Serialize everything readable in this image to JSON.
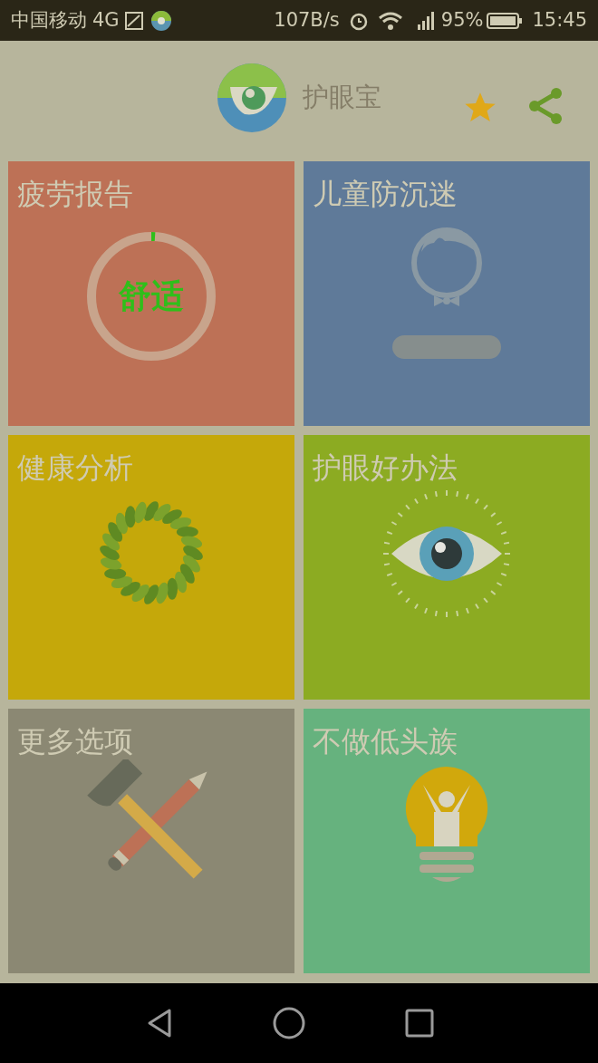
{
  "status_bar": {
    "carrier": "中国移动",
    "network": "4G",
    "speed": "107B/s",
    "battery": "95%",
    "time": "15:45"
  },
  "header": {
    "title": "护眼宝"
  },
  "tiles": [
    {
      "title": "疲劳报告",
      "kind": "ring",
      "color": "#bd7156",
      "status": "舒适",
      "level": 0.01
    },
    {
      "title": "儿童防沉迷",
      "kind": "boy",
      "color": "#5f7a99"
    },
    {
      "title": "健康分析",
      "kind": "wreath",
      "color": "#c5a80a"
    },
    {
      "title": "护眼好办法",
      "kind": "eye",
      "color": "#8cab22"
    },
    {
      "title": "更多选项",
      "kind": "tools",
      "color": "#8b8873"
    },
    {
      "title": "不做低头族",
      "kind": "bulb",
      "color": "#66b27e"
    }
  ]
}
